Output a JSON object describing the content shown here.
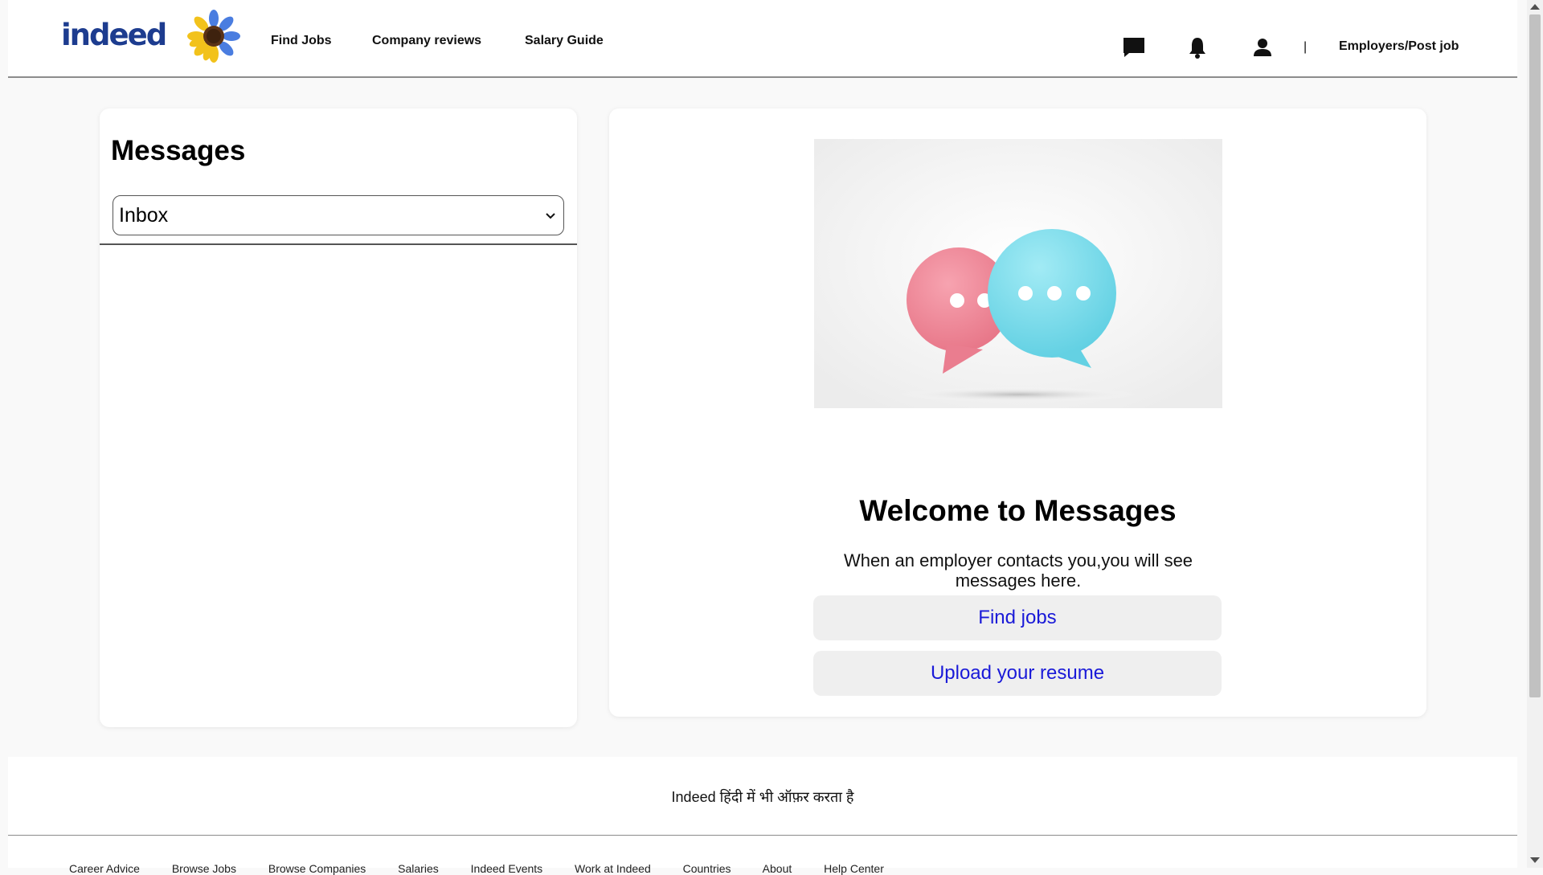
{
  "header": {
    "logo_text": "indeed",
    "nav": [
      "Find Jobs",
      "Company reviews",
      "Salary Guide"
    ],
    "icons": [
      "chat-icon",
      "bell-icon",
      "person-icon"
    ],
    "separator": "|",
    "employers_label": "Employers/Post job"
  },
  "messages": {
    "title": "Messages",
    "folder_selected": "Inbox"
  },
  "welcome": {
    "title": "Welcome to Messages",
    "text": "When an employer contacts you,you will see messages here.",
    "find_jobs_label": "Find jobs",
    "upload_resume_label": "Upload your resume"
  },
  "footer": {
    "language_offer": "Indeed हिंदी में भी ऑफ़र करता है",
    "links": [
      "Career Advice",
      "Browse Jobs",
      "Browse Companies",
      "Salaries",
      "Indeed Events",
      "Work at Indeed",
      "Countries",
      "About",
      "Help Center"
    ]
  },
  "colors": {
    "logo_blue": "#1d3c8f",
    "link_blue": "#1a1ad8",
    "button_bg": "#efefef",
    "bubble_pink": "#f08a9c",
    "bubble_cyan": "#7fdcec"
  }
}
